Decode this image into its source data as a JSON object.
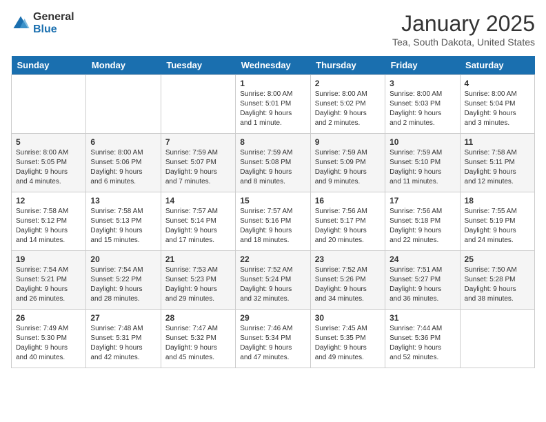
{
  "header": {
    "logo_general": "General",
    "logo_blue": "Blue",
    "title": "January 2025",
    "subtitle": "Tea, South Dakota, United States"
  },
  "days_of_week": [
    "Sunday",
    "Monday",
    "Tuesday",
    "Wednesday",
    "Thursday",
    "Friday",
    "Saturday"
  ],
  "weeks": [
    [
      {
        "day": "",
        "content": ""
      },
      {
        "day": "",
        "content": ""
      },
      {
        "day": "",
        "content": ""
      },
      {
        "day": "1",
        "content": "Sunrise: 8:00 AM\nSunset: 5:01 PM\nDaylight: 9 hours\nand 1 minute."
      },
      {
        "day": "2",
        "content": "Sunrise: 8:00 AM\nSunset: 5:02 PM\nDaylight: 9 hours\nand 2 minutes."
      },
      {
        "day": "3",
        "content": "Sunrise: 8:00 AM\nSunset: 5:03 PM\nDaylight: 9 hours\nand 2 minutes."
      },
      {
        "day": "4",
        "content": "Sunrise: 8:00 AM\nSunset: 5:04 PM\nDaylight: 9 hours\nand 3 minutes."
      }
    ],
    [
      {
        "day": "5",
        "content": "Sunrise: 8:00 AM\nSunset: 5:05 PM\nDaylight: 9 hours\nand 4 minutes."
      },
      {
        "day": "6",
        "content": "Sunrise: 8:00 AM\nSunset: 5:06 PM\nDaylight: 9 hours\nand 6 minutes."
      },
      {
        "day": "7",
        "content": "Sunrise: 7:59 AM\nSunset: 5:07 PM\nDaylight: 9 hours\nand 7 minutes."
      },
      {
        "day": "8",
        "content": "Sunrise: 7:59 AM\nSunset: 5:08 PM\nDaylight: 9 hours\nand 8 minutes."
      },
      {
        "day": "9",
        "content": "Sunrise: 7:59 AM\nSunset: 5:09 PM\nDaylight: 9 hours\nand 9 minutes."
      },
      {
        "day": "10",
        "content": "Sunrise: 7:59 AM\nSunset: 5:10 PM\nDaylight: 9 hours\nand 11 minutes."
      },
      {
        "day": "11",
        "content": "Sunrise: 7:58 AM\nSunset: 5:11 PM\nDaylight: 9 hours\nand 12 minutes."
      }
    ],
    [
      {
        "day": "12",
        "content": "Sunrise: 7:58 AM\nSunset: 5:12 PM\nDaylight: 9 hours\nand 14 minutes."
      },
      {
        "day": "13",
        "content": "Sunrise: 7:58 AM\nSunset: 5:13 PM\nDaylight: 9 hours\nand 15 minutes."
      },
      {
        "day": "14",
        "content": "Sunrise: 7:57 AM\nSunset: 5:14 PM\nDaylight: 9 hours\nand 17 minutes."
      },
      {
        "day": "15",
        "content": "Sunrise: 7:57 AM\nSunset: 5:16 PM\nDaylight: 9 hours\nand 18 minutes."
      },
      {
        "day": "16",
        "content": "Sunrise: 7:56 AM\nSunset: 5:17 PM\nDaylight: 9 hours\nand 20 minutes."
      },
      {
        "day": "17",
        "content": "Sunrise: 7:56 AM\nSunset: 5:18 PM\nDaylight: 9 hours\nand 22 minutes."
      },
      {
        "day": "18",
        "content": "Sunrise: 7:55 AM\nSunset: 5:19 PM\nDaylight: 9 hours\nand 24 minutes."
      }
    ],
    [
      {
        "day": "19",
        "content": "Sunrise: 7:54 AM\nSunset: 5:21 PM\nDaylight: 9 hours\nand 26 minutes."
      },
      {
        "day": "20",
        "content": "Sunrise: 7:54 AM\nSunset: 5:22 PM\nDaylight: 9 hours\nand 28 minutes."
      },
      {
        "day": "21",
        "content": "Sunrise: 7:53 AM\nSunset: 5:23 PM\nDaylight: 9 hours\nand 29 minutes."
      },
      {
        "day": "22",
        "content": "Sunrise: 7:52 AM\nSunset: 5:24 PM\nDaylight: 9 hours\nand 32 minutes."
      },
      {
        "day": "23",
        "content": "Sunrise: 7:52 AM\nSunset: 5:26 PM\nDaylight: 9 hours\nand 34 minutes."
      },
      {
        "day": "24",
        "content": "Sunrise: 7:51 AM\nSunset: 5:27 PM\nDaylight: 9 hours\nand 36 minutes."
      },
      {
        "day": "25",
        "content": "Sunrise: 7:50 AM\nSunset: 5:28 PM\nDaylight: 9 hours\nand 38 minutes."
      }
    ],
    [
      {
        "day": "26",
        "content": "Sunrise: 7:49 AM\nSunset: 5:30 PM\nDaylight: 9 hours\nand 40 minutes."
      },
      {
        "day": "27",
        "content": "Sunrise: 7:48 AM\nSunset: 5:31 PM\nDaylight: 9 hours\nand 42 minutes."
      },
      {
        "day": "28",
        "content": "Sunrise: 7:47 AM\nSunset: 5:32 PM\nDaylight: 9 hours\nand 45 minutes."
      },
      {
        "day": "29",
        "content": "Sunrise: 7:46 AM\nSunset: 5:34 PM\nDaylight: 9 hours\nand 47 minutes."
      },
      {
        "day": "30",
        "content": "Sunrise: 7:45 AM\nSunset: 5:35 PM\nDaylight: 9 hours\nand 49 minutes."
      },
      {
        "day": "31",
        "content": "Sunrise: 7:44 AM\nSunset: 5:36 PM\nDaylight: 9 hours\nand 52 minutes."
      },
      {
        "day": "",
        "content": ""
      }
    ]
  ]
}
